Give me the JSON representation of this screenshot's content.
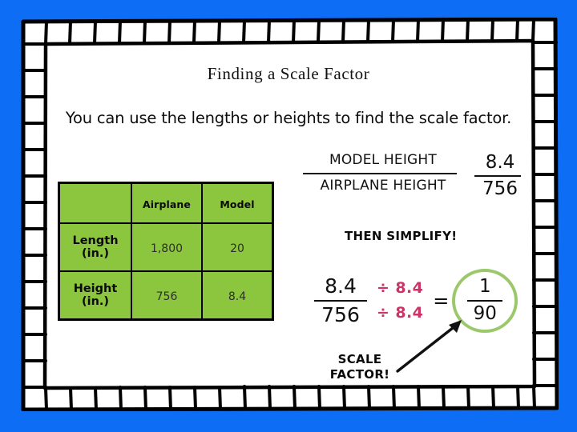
{
  "slide": {
    "title": "Finding a Scale Factor",
    "intro_sentence": "You can use the lengths or heights to find the scale factor.",
    "background_color": "#0d6ef5",
    "page_color": "#ffffff",
    "border_style": "hand-drawn-ticket-frame"
  },
  "colors": {
    "background_blue": "#0d6ef5",
    "table_green": "#8cc63f",
    "circle_green": "#9bc86a",
    "divisor_pink": "#cc3366",
    "ink_black": "#101010"
  },
  "table": {
    "column_headers": [
      "",
      "Airplane",
      "Model"
    ],
    "rows": [
      {
        "label": "Length\n(in.)",
        "label_line1": "Length",
        "label_line2": "(in.)",
        "airplane": "1,800",
        "model": "20"
      },
      {
        "label": "Height\n(in.)",
        "label_line1": "Height",
        "label_line2": "(in.)",
        "airplane": "756",
        "model": "8.4"
      }
    ]
  },
  "ratio_words": {
    "numerator": "MODEL HEIGHT",
    "denominator": "AIRPLANE HEIGHT"
  },
  "ratio_numbers": {
    "numerator": "8.4",
    "denominator": "756"
  },
  "simplify": {
    "callout": "THEN SIMPLIFY!",
    "original_numerator": "8.4",
    "original_denominator": "756",
    "divisor_top": "÷ 8.4",
    "divisor_bottom": "÷ 8.4",
    "equals": "=",
    "answer_numerator": "1",
    "answer_denominator": "90"
  },
  "annotation": {
    "scale_factor_line1": "SCALE",
    "scale_factor_line2": "FACTOR!"
  }
}
